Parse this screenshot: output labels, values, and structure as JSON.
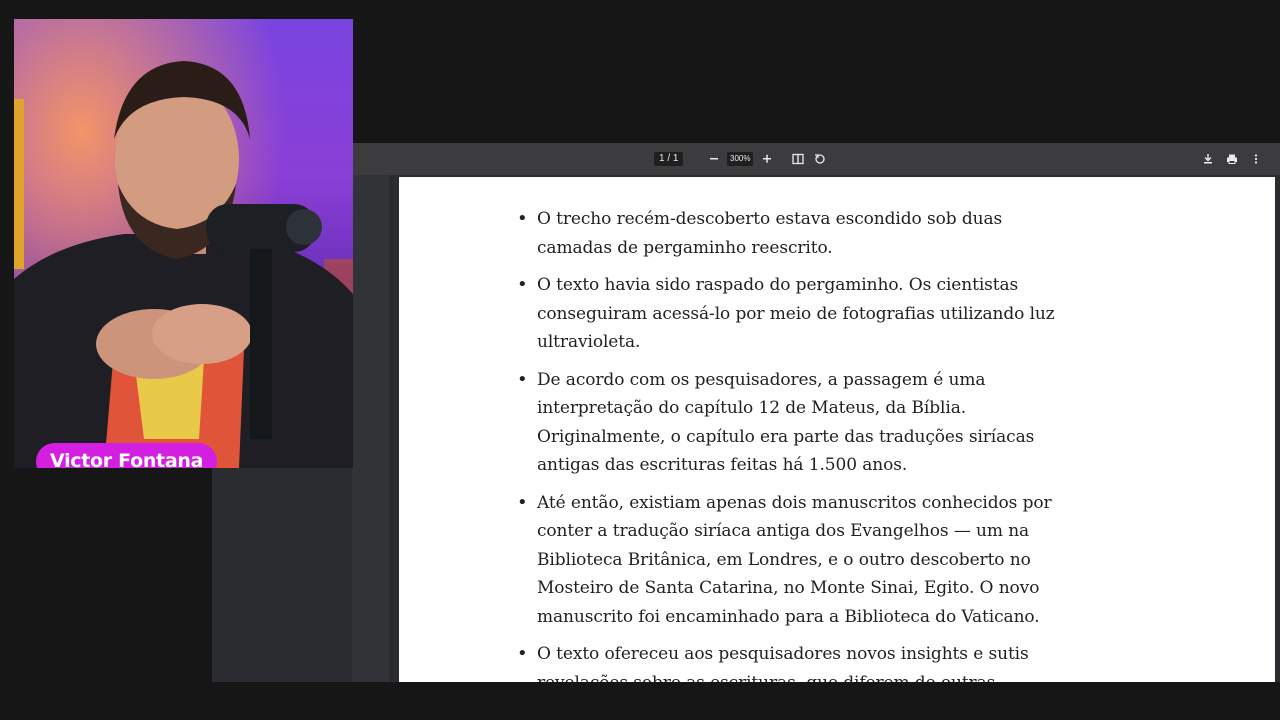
{
  "viewer": {
    "page_current": "1",
    "page_separator": "/",
    "page_total": "1",
    "zoom_out_icon": "minus-icon",
    "zoom": "300%",
    "zoom_in_icon": "plus-icon",
    "fit_icon": "fit-page-icon",
    "rotate_icon": "rotate-icon",
    "download_icon": "download-icon",
    "print_icon": "print-icon",
    "more_icon": "more-vert-icon"
  },
  "document": {
    "bullets": [
      "O trecho recém-descoberto estava escondido sob duas camadas de pergaminho reescrito.",
      "O texto havia sido raspado do pergaminho. Os cientistas conseguiram acessá-lo por meio de fotografias utilizando luz ultravioleta.",
      "De acordo com os pesquisadores, a passagem é uma interpretação do capítulo 12 de Mateus, da Bíblia. Originalmente, o capítulo era parte das traduções siríacas antigas das escrituras feitas há 1.500 anos.",
      "Até então, existiam apenas dois manuscritos conhecidos por conter a tradução siríaca antiga dos Evangelhos — um na Biblioteca Britânica, em Londres, e o outro descoberto no Mosteiro de Santa Catarina, no Monte Sinai, Egito. O novo manuscrito foi encaminhado para a Biblioteca do Vaticano.",
      "O texto ofereceu aos pesquisadores novos insights e sutis revelações sobre as escrituras, que diferem de outras"
    ]
  },
  "overlay": {
    "name_tag": "Victor Fontana",
    "accent": "#d21fe0"
  }
}
